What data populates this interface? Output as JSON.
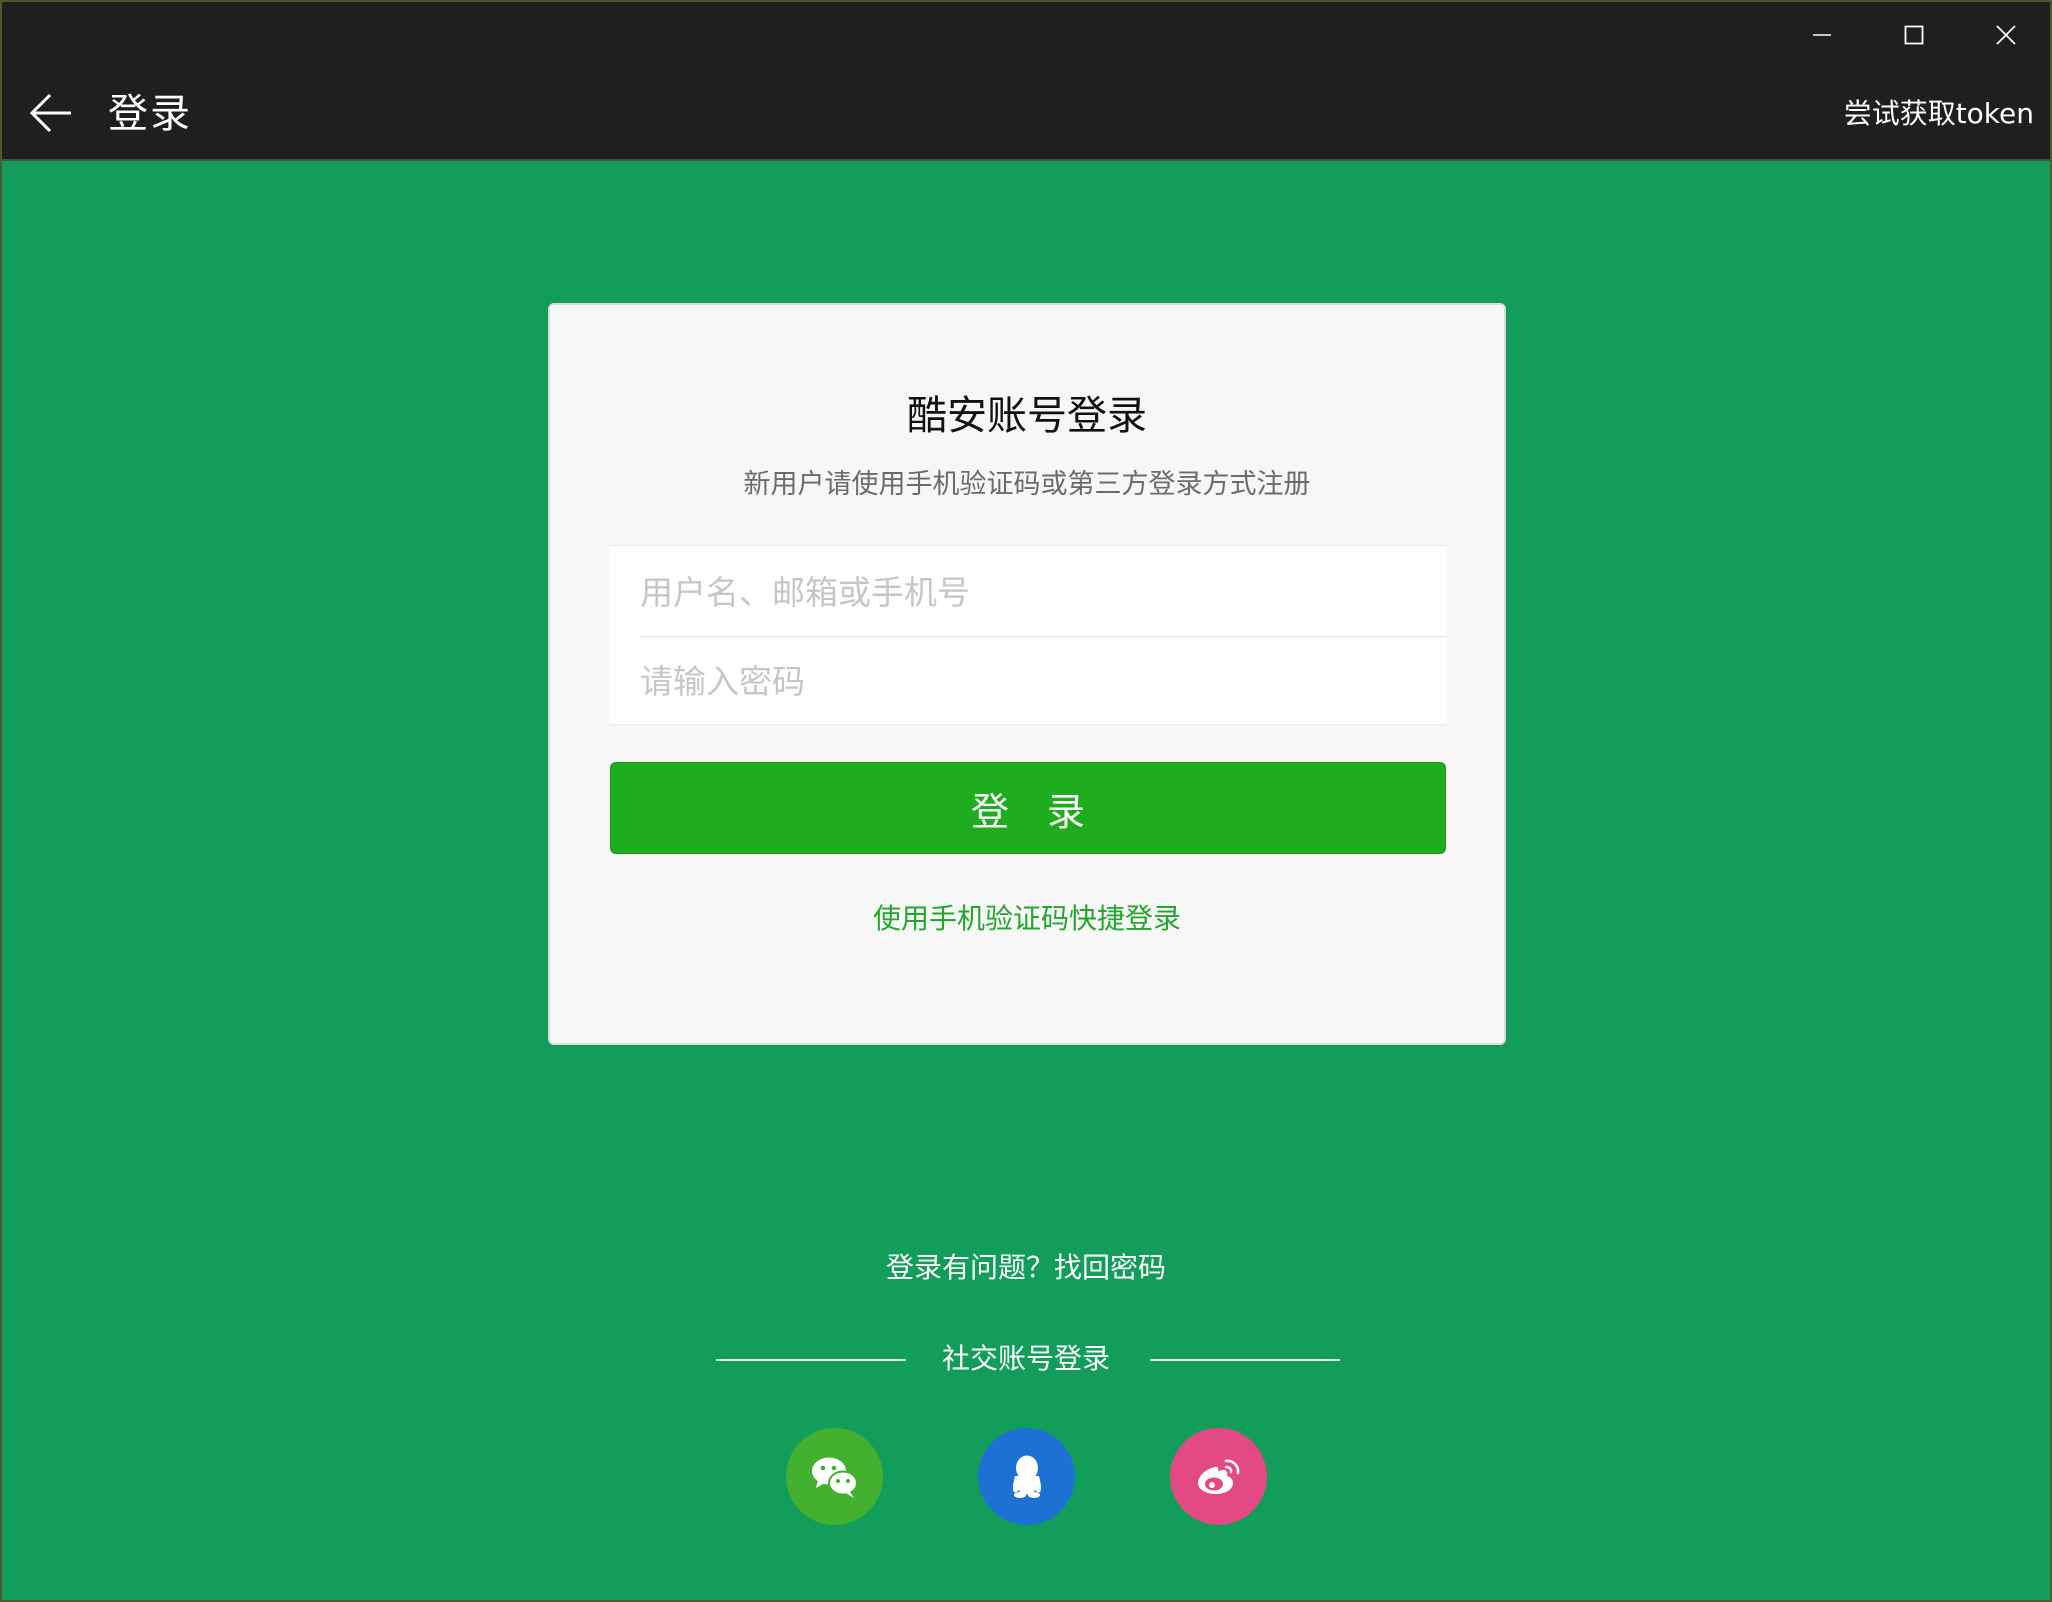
{
  "window": {
    "controls": [
      "minimize",
      "maximize",
      "close"
    ]
  },
  "header": {
    "title": "登录",
    "back_icon": "arrow-left-icon",
    "token_action": "尝试获取token"
  },
  "login_card": {
    "title": "酷安账号登录",
    "subtitle": "新用户请使用手机验证码或第三方登录方式注册",
    "username": {
      "value": "",
      "placeholder": "用户名、邮箱或手机号"
    },
    "password": {
      "value": "",
      "placeholder": "请输入密码"
    },
    "submit_label": "登录",
    "sms_login_link": "使用手机验证码快捷登录"
  },
  "footer": {
    "forgot_link": "登录有问题？找回密码",
    "social_title": "社交账号登录",
    "social_buttons": [
      {
        "name": "wechat",
        "icon": "wechat-icon",
        "color": "#44b02f"
      },
      {
        "name": "qq",
        "icon": "qq-icon",
        "color": "#1d71d2"
      },
      {
        "name": "weibo",
        "icon": "weibo-icon",
        "color": "#e34a84"
      }
    ]
  },
  "colors": {
    "background": "#129d5a",
    "titlebar": "#1f1f1f",
    "primary_button": "#1fac1e",
    "link": "#23a72b"
  }
}
